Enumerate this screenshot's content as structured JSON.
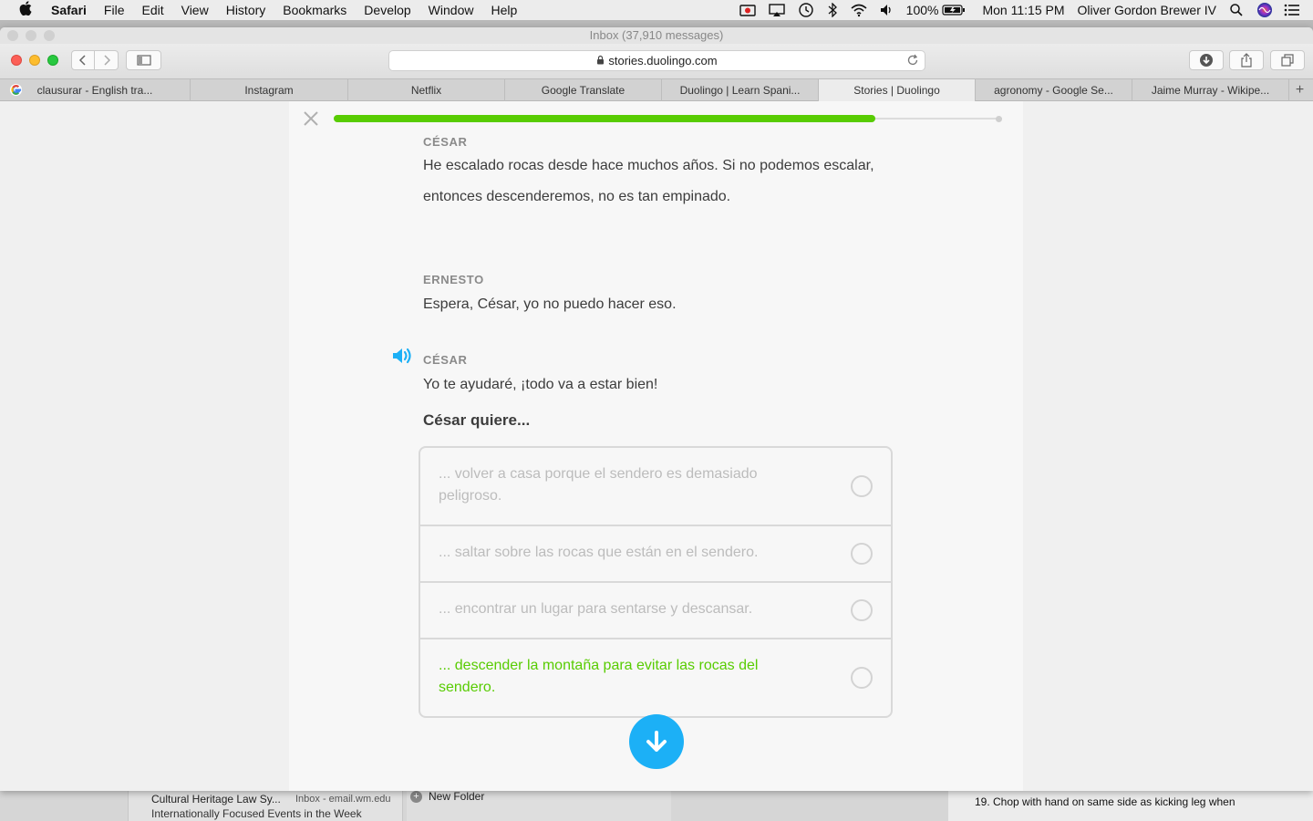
{
  "menubar": {
    "app": "Safari",
    "items": [
      "File",
      "Edit",
      "View",
      "History",
      "Bookmarks",
      "Develop",
      "Window",
      "Help"
    ],
    "battery": "100%",
    "clock": "Mon 11:15 PM",
    "user": "Oliver Gordon Brewer IV"
  },
  "window": {
    "title": "Inbox (37,910 messages)",
    "url": "stories.duolingo.com"
  },
  "tabs": [
    {
      "label": "clausurar - English tra...",
      "active": false
    },
    {
      "label": "Instagram",
      "active": false
    },
    {
      "label": "Netflix",
      "active": false
    },
    {
      "label": "Google Translate",
      "active": false
    },
    {
      "label": "Duolingo | Learn Spani...",
      "active": false
    },
    {
      "label": "Stories | Duolingo",
      "active": true
    },
    {
      "label": "agronomy - Google Se...",
      "active": false
    },
    {
      "label": "Jaime Murray - Wikipe...",
      "active": false
    }
  ],
  "story": {
    "progress": 0.81,
    "dialog": [
      {
        "speaker": "CÉSAR",
        "line1": "He escalado rocas desde hace muchos años. Si no podemos escalar,",
        "line2": "entonces descenderemos, no es tan empinado."
      },
      {
        "speaker": "ERNESTO",
        "line1": "Espera, César, yo no puedo hacer eso."
      },
      {
        "speaker": "CÉSAR",
        "line1": "Yo te ayudaré, ¡todo va a estar bien!"
      }
    ],
    "question": "César quiere...",
    "options": [
      {
        "text": "... volver a casa porque el sendero es demasiado peligroso.",
        "correct": false
      },
      {
        "text": "... saltar sobre las rocas que están en el sendero.",
        "correct": false
      },
      {
        "text": "... encontrar un lugar para sentarse y descansar.",
        "correct": false
      },
      {
        "text": "... descender la montaña para evitar las rocas del sendero.",
        "correct": true
      }
    ]
  },
  "background": {
    "mail_subject": "Cultural Heritage Law Sy...",
    "mail_account": "Inbox - email.wm.edu",
    "mail_preview": "Internationally Focused Events in the Week",
    "folder_label": "New Folder",
    "note_text": "19.  Chop with hand on same side as kicking leg when"
  },
  "colors": {
    "accent_green": "#58cc02",
    "accent_blue": "#1cb0f6"
  }
}
